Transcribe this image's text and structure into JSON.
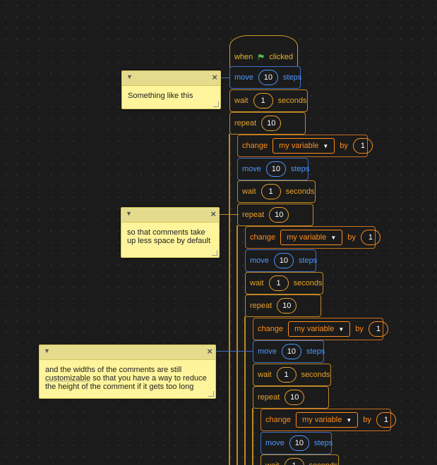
{
  "script": {
    "hat": {
      "when": "when",
      "clicked": "clicked",
      "flag_color": "#4cbf56"
    },
    "move": {
      "label": "move",
      "value": "10",
      "unit": "steps"
    },
    "wait": {
      "label": "wait",
      "value": "1",
      "unit": "seconds"
    },
    "repeat": {
      "label": "repeat",
      "value": "10"
    },
    "change": {
      "label": "change",
      "variable": "my variable",
      "by": "by",
      "value": "1"
    }
  },
  "comments": [
    {
      "text": "Something like this"
    },
    {
      "text": "so that comments take up less space by default"
    },
    {
      "text_before": "and the widths of the comments are still ",
      "underlined": "customizable",
      "text_after": " so that you have a way to reduce the height of the comment if it gets too long"
    }
  ],
  "colors": {
    "events": "#e6b521",
    "motion": "#4c97ff",
    "control": "#e8a22c",
    "variables": "#ff8c1a",
    "comment_bg": "#fef49c",
    "comment_header": "#e4db8c"
  }
}
